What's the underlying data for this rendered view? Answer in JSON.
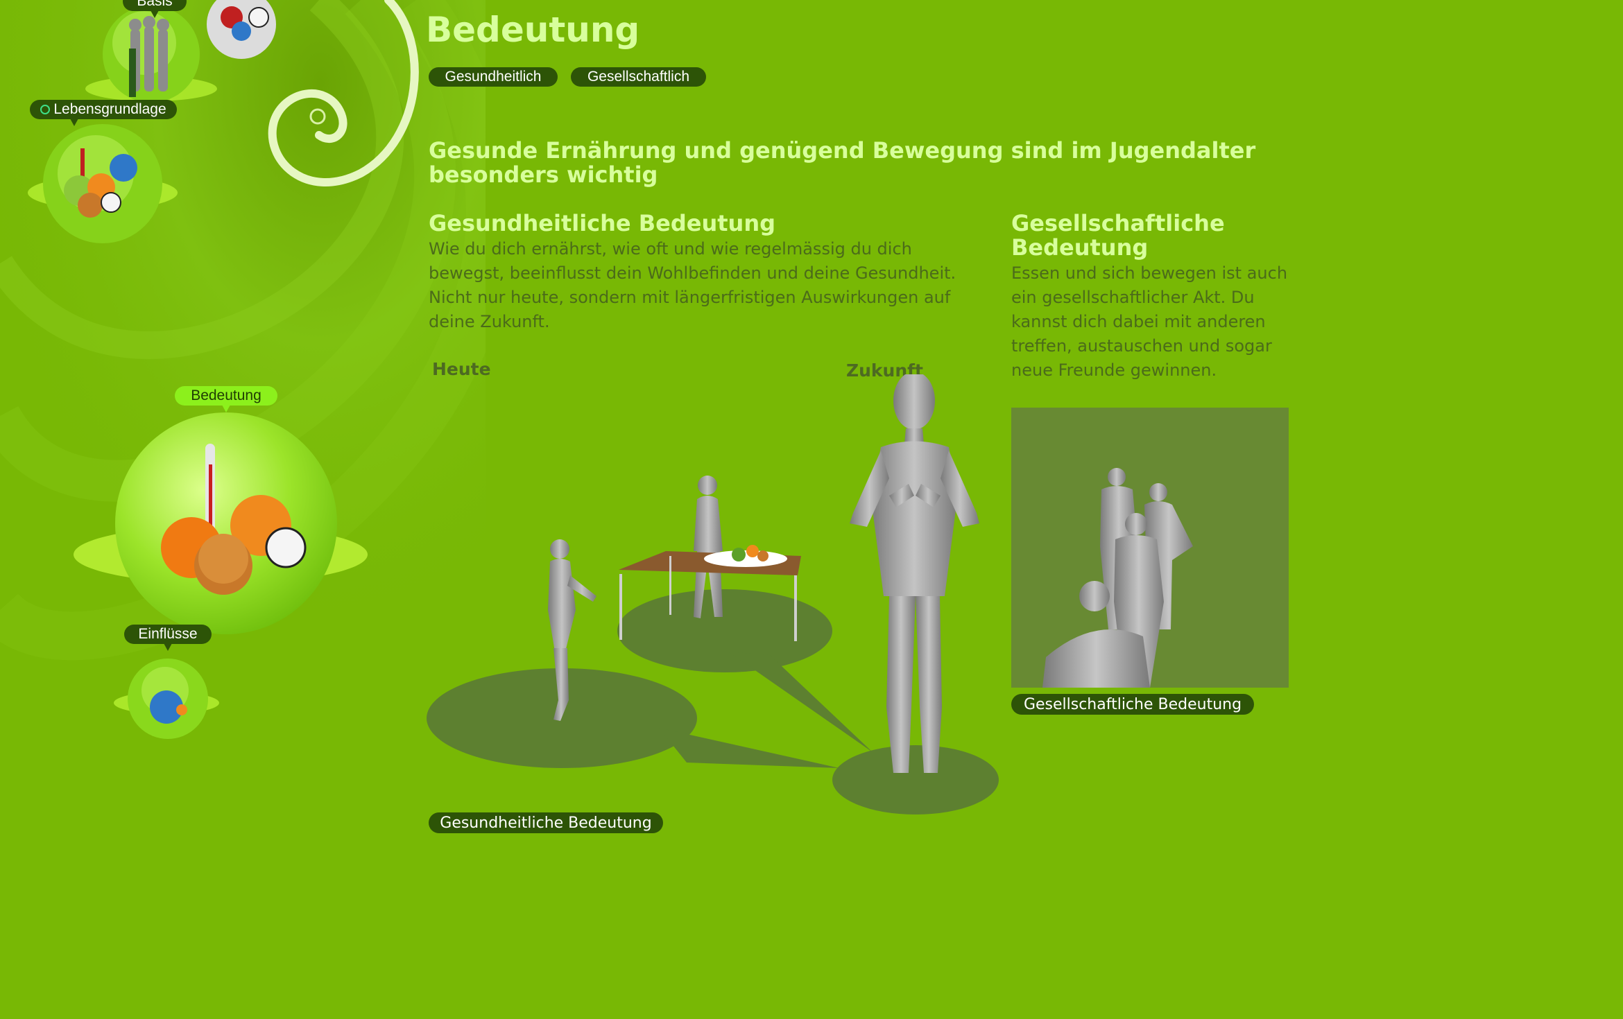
{
  "nav": {
    "basis_label": "Basis",
    "lebensgrundlage_label": "Lebensgrundlage",
    "bedeutung_label": "Bedeutung",
    "einfluesse_label": "Einflüsse"
  },
  "header": {
    "title": "Bedeutung",
    "tabs": [
      "Gesundheitlich",
      "Gesellschaftlich"
    ]
  },
  "content": {
    "lead": "Gesunde Ernährung und genügend Bewegung sind im Jugendalter besonders wichtig",
    "health": {
      "title": "Gesundheitliche Bedeutung",
      "text": "Wie du dich ernährst, wie oft und wie regelmässig du dich bewegst, beeinflusst dein Wohlbefinden und deine Gesundheit. Nicht nur heute, sondern mit längerfristigen Auswirkungen auf deine Zukunft.",
      "label_today": "Heute",
      "label_future": "Zukunft",
      "button": "Gesundheitliche Bedeutung"
    },
    "social": {
      "title": "Gesellschaftliche Bedeutung",
      "text": "Essen und sich bewegen ist auch ein gesellschaftlicher Akt. Du kannst dich dabei mit anderen treffen, austauschen und sogar neue Freunde gewinnen.",
      "button": "Gesellschaftliche Bedeutung"
    }
  },
  "colors": {
    "background": "#78b805",
    "title": "#d8ff9c",
    "pill": "#2d5407",
    "pill_active": "#8cf01c",
    "body_text": "#4b6b1a",
    "photo_bg": "#688a33"
  }
}
